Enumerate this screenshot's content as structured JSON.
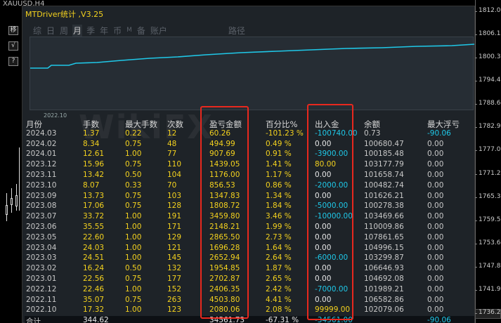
{
  "symbol": "XAUUSD,H4",
  "panel_title": "MTDriver统计 ,V3.25",
  "side_buttons": [
    "移",
    "√",
    "?"
  ],
  "tabs": [
    {
      "label": "综",
      "active": false,
      "small": false
    },
    {
      "label": "日",
      "active": false,
      "small": false
    },
    {
      "label": "周",
      "active": false,
      "small": false
    },
    {
      "label": "月",
      "active": true,
      "small": false
    },
    {
      "label": "季",
      "active": false,
      "small": false
    },
    {
      "label": "年",
      "active": false,
      "small": false
    },
    {
      "label": "币",
      "active": false,
      "small": false
    },
    {
      "label": "M",
      "active": false,
      "small": true
    },
    {
      "label": "备",
      "active": false,
      "small": false
    },
    {
      "label": "账户",
      "active": false,
      "small": false
    },
    {
      "label": "路径",
      "active": false,
      "small": false,
      "path": true
    }
  ],
  "mini_chart_date": "2022.10",
  "watermark": "WikiFX",
  "price_axis": [
    "1812.00",
    "1806.10",
    "1800.30",
    "1794.40",
    "1788.60",
    "1782.90",
    "1777.00",
    "1771.20",
    "1765.30",
    "1759.50",
    "1753.60",
    "1747.80",
    "1741.90",
    "1736.20"
  ],
  "headers": [
    "月份",
    "手数",
    "最大手数",
    "次数",
    "盈亏金额",
    "百分比%",
    "出入金",
    "余额",
    "最大浮亏"
  ],
  "rows": [
    [
      "2024.03",
      "1.37",
      "0.22",
      "12",
      "60.26",
      "-101.23 %",
      "-100740.00",
      "0.73",
      "-90.06"
    ],
    [
      "2024.02",
      "8.34",
      "0.75",
      "48",
      "494.99",
      "0.49 %",
      "0.00",
      "100680.47",
      "0.00"
    ],
    [
      "2024.01",
      "12.61",
      "1.00",
      "77",
      "907.69",
      "0.91 %",
      "-3900.00",
      "100185.48",
      "0.00"
    ],
    [
      "2023.12",
      "15.96",
      "0.75",
      "110",
      "1439.05",
      "1.41 %",
      "80.00",
      "103177.79",
      "0.00"
    ],
    [
      "2023.11",
      "13.42",
      "0.50",
      "104",
      "1176.00",
      "1.17 %",
      "0.00",
      "101658.74",
      "0.00"
    ],
    [
      "2023.10",
      "8.07",
      "0.33",
      "70",
      "856.53",
      "0.86 %",
      "-2000.00",
      "100482.74",
      "0.00"
    ],
    [
      "2023.09",
      "13.73",
      "0.75",
      "103",
      "1347.83",
      "1.34 %",
      "0.00",
      "101626.21",
      "0.00"
    ],
    [
      "2023.08",
      "17.06",
      "0.75",
      "128",
      "1808.72",
      "1.84 %",
      "-5000.00",
      "100278.38",
      "0.00"
    ],
    [
      "2023.07",
      "33.72",
      "1.00",
      "191",
      "3459.80",
      "3.46 %",
      "-10000.00",
      "103469.66",
      "0.00"
    ],
    [
      "2023.06",
      "35.55",
      "1.00",
      "171",
      "2148.21",
      "1.99 %",
      "0.00",
      "110009.86",
      "0.00"
    ],
    [
      "2023.05",
      "22.60",
      "1.00",
      "129",
      "2865.50",
      "2.73 %",
      "0.00",
      "107861.65",
      "0.00"
    ],
    [
      "2023.04",
      "24.03",
      "1.00",
      "121",
      "1696.28",
      "1.64 %",
      "0.00",
      "104996.15",
      "0.00"
    ],
    [
      "2023.03",
      "24.51",
      "1.00",
      "145",
      "2652.94",
      "2.64 %",
      "-6000.00",
      "103299.87",
      "0.00"
    ],
    [
      "2023.02",
      "16.24",
      "0.50",
      "132",
      "1954.85",
      "1.87 %",
      "0.00",
      "106646.93",
      "0.00"
    ],
    [
      "2023.01",
      "22.56",
      "0.75",
      "177",
      "2702.87",
      "2.65 %",
      "0.00",
      "104692.08",
      "0.00"
    ],
    [
      "2022.12",
      "22.46",
      "1.00",
      "152",
      "2406.35",
      "2.42 %",
      "-7000.00",
      "101989.21",
      "0.00"
    ],
    [
      "2022.11",
      "35.07",
      "0.75",
      "263",
      "4503.80",
      "4.41 %",
      "0.00",
      "106582.86",
      "0.00"
    ],
    [
      "2022.10",
      "17.32",
      "1.00",
      "123",
      "2080.06",
      "2.08 %",
      "99999.00",
      "102079.06",
      "0.00"
    ]
  ],
  "total": [
    "合计",
    "344.62",
    "",
    "",
    "34561.73",
    "-67.31 %",
    "-34561.00",
    "",
    "-90.06"
  ],
  "colors": {
    "accent_yellow": "#f4d21e",
    "cyan": "#1fc8e8",
    "highlight_red": "#e8281e",
    "panel_bg": "#1e2328"
  }
}
